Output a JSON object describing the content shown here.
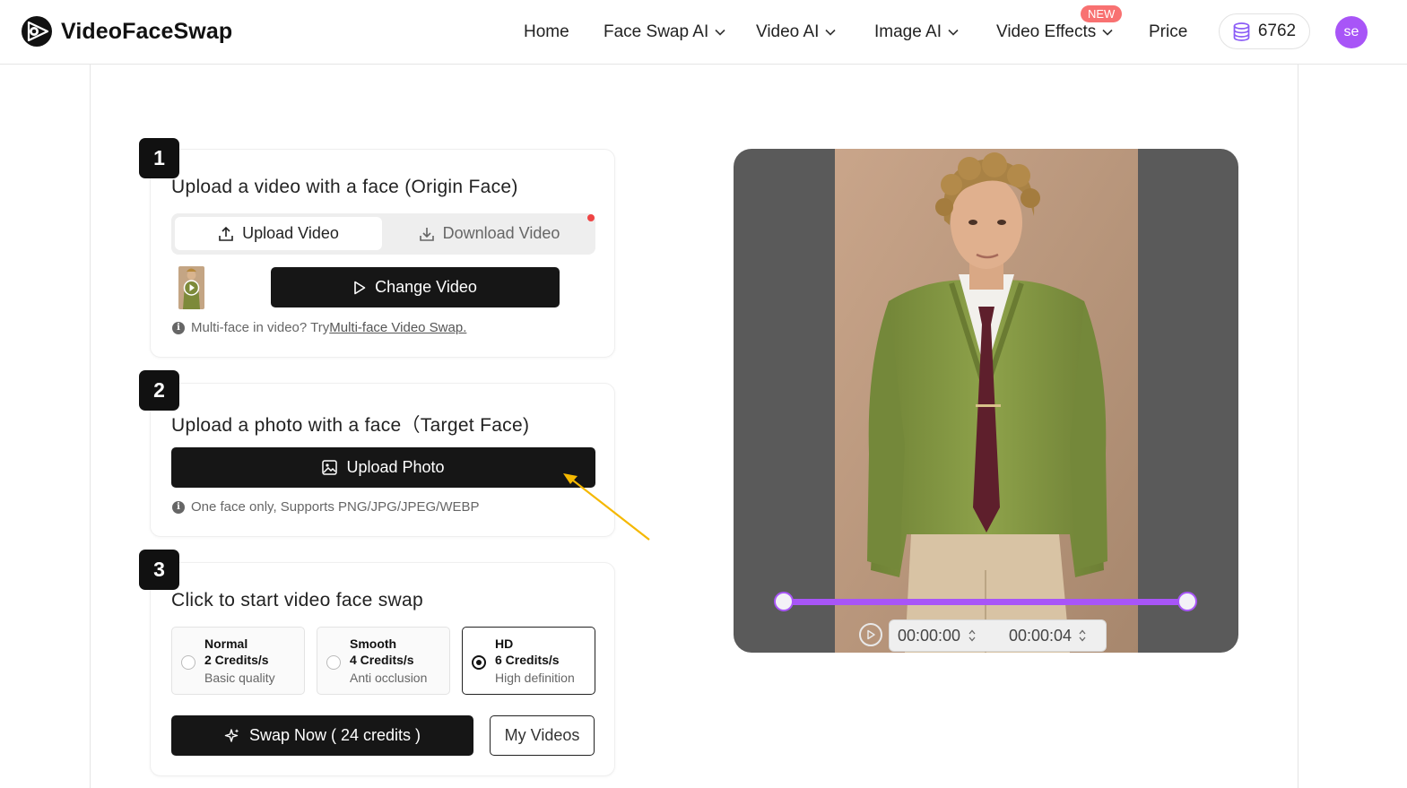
{
  "header": {
    "brand": "VideoFaceSwap",
    "nav": [
      {
        "label": "Home",
        "dropdown": false
      },
      {
        "label": "Face Swap AI",
        "dropdown": true
      },
      {
        "label": "Video AI",
        "dropdown": true
      },
      {
        "label": "Image AI",
        "dropdown": true
      },
      {
        "label": "Video Effects",
        "dropdown": true,
        "badge": "NEW"
      },
      {
        "label": "Price",
        "dropdown": false
      }
    ],
    "credits": "6762",
    "avatar_initials": "se"
  },
  "step1": {
    "number": "1",
    "title": "Upload a video with a face (Origin Face)",
    "tab_upload": "Upload Video",
    "tab_download": "Download Video",
    "change_button": "Change Video",
    "note_prefix": "Multi-face in video? Try ",
    "note_link": "Multi-face Video Swap."
  },
  "step2": {
    "number": "2",
    "title": "Upload a photo with a face（Target Face)",
    "upload_button": "Upload Photo",
    "note": "One face only, Supports PNG/JPG/JPEG/WEBP"
  },
  "step3": {
    "number": "3",
    "title": "Click to start video face swap",
    "options": [
      {
        "name": "Normal",
        "credits": "2 Credits/s",
        "desc": "Basic quality",
        "selected": false
      },
      {
        "name": "Smooth",
        "credits": "4 Credits/s",
        "desc": "Anti occlusion",
        "selected": false
      },
      {
        "name": "HD",
        "credits": "6 Credits/s",
        "desc": "High definition",
        "selected": true
      }
    ],
    "swap_button": "Swap Now ( 24 credits )",
    "my_videos_button": "My Videos"
  },
  "preview": {
    "start_time": "00:00:00",
    "end_time": "00:00:04"
  },
  "colors": {
    "accent": "#a855f7",
    "badge": "#f87171",
    "dark_button": "#161616",
    "annotation_arrow": "#f5b800"
  }
}
